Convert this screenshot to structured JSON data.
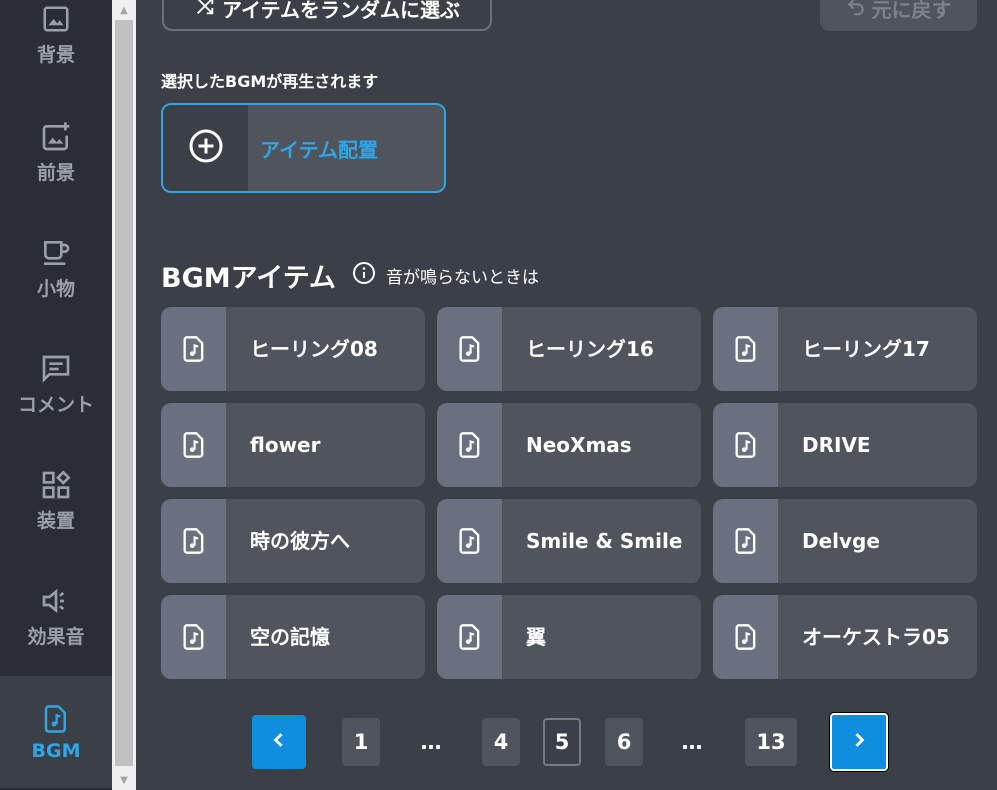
{
  "sidebar": {
    "items": [
      {
        "label": "背景",
        "icon": "image-icon"
      },
      {
        "label": "前景",
        "icon": "image-add-icon"
      },
      {
        "label": "小物",
        "icon": "cup-icon"
      },
      {
        "label": "コメント",
        "icon": "comment-icon"
      },
      {
        "label": "装置",
        "icon": "widgets-icon"
      },
      {
        "label": "効果音",
        "icon": "speaker-icon"
      },
      {
        "label": "BGM",
        "icon": "music-file-icon"
      }
    ],
    "active_color": "#2ea6e8"
  },
  "toolbar": {
    "random_label": "アイテムをランダムに選ぶ",
    "undo_label": "元に戻す"
  },
  "caption": "選択したBGMが再生されます",
  "place_button": {
    "label": "アイテム配置"
  },
  "section": {
    "title": "BGMアイテム",
    "info_text": "音が鳴らないときは"
  },
  "items": [
    "ヒーリング08",
    "ヒーリング16",
    "ヒーリング17",
    "flower",
    "NeoXmas",
    "DRIVE",
    "時の彼方へ",
    "Smile & Smile",
    "Delvge",
    "空の記憶",
    "翼",
    "オーケストラ05"
  ],
  "pagination": {
    "pages": [
      "1",
      "…",
      "4",
      "5",
      "6",
      "…",
      "13"
    ],
    "current": "5"
  },
  "colors": {
    "accent": "#2ea6e8",
    "pager_arrow": "#0f8ee0"
  }
}
